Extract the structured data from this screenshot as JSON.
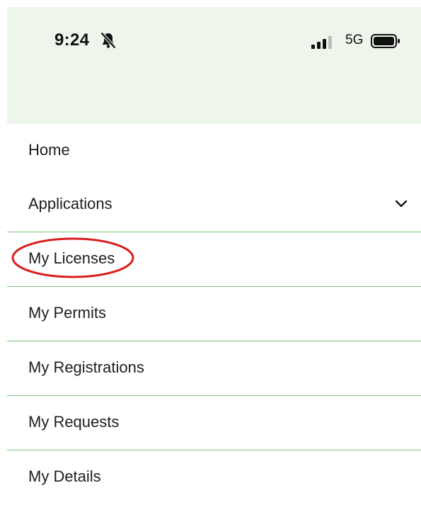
{
  "status_bar": {
    "time": "9:24",
    "network": "5G",
    "icons": [
      "bell-slash-icon",
      "signal-bars-icon",
      "battery-icon"
    ]
  },
  "menu": {
    "items": [
      {
        "label": "Home"
      },
      {
        "label": "Applications",
        "icon": "chevron-down-icon"
      },
      {
        "label": "My Licenses",
        "annotated": true
      },
      {
        "label": "My Permits"
      },
      {
        "label": "My Registrations"
      },
      {
        "label": "My Requests"
      },
      {
        "label": "My Details"
      }
    ]
  },
  "colors": {
    "header_bg": "#eef6ec",
    "divider": "#7cc47a",
    "annotation_ring": "#d81e1e"
  }
}
